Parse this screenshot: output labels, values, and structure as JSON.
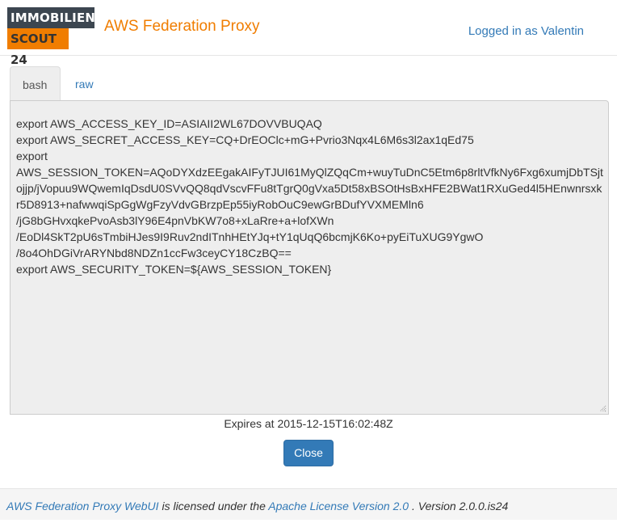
{
  "header": {
    "logo_line1": "IMMOBILIEN",
    "logo_line2": "SCOUT 24",
    "app_title": "AWS Federation Proxy",
    "user_link": "Logged in as Valentin"
  },
  "tabs": [
    {
      "label": "bash",
      "active": true
    },
    {
      "label": "raw",
      "active": false
    }
  ],
  "credentials_text": "export AWS_ACCESS_KEY_ID=ASIAII2WL67DOVVBUQAQ\nexport AWS_SECRET_ACCESS_KEY=CQ+DrEOClc+mG+Pvrio3Nqx4L6M6s3l2ax1qEd75\nexport\nAWS_SESSION_TOKEN=AQoDYXdzEEgakAIFyTJUI61MyQlZQqCm+wuyTuDnC5Etm6p8rltVfkNy6Fxg6xumjDbTSjtojjp/jVopuu9WQwemIqDsdU0SVvQQ8qdVscvFFu8tTgrQ0gVxa5Dt58xBSOtHsBxHFE2BWat1RXuGed4l5HEnwnrsxkr5D8913+nafwwqiSpGgWgFzyVdvGBrzpEp55iyRobOuC9ewGrBDufYVXMEMln6\n/jG8bGHvxqkePvoAsb3lY96E4pnVbKW7o8+xLaRre+a+lofXWn\n/EoDl4SkT2pU6sTmbiHJes9I9Ruv2ndITnhHEtYJq+tY1qUqQ6bcmjK6Ko+pyEiTuXUG9YgwO\n/8o4OhDGiVrARYNbd8NDZn1ccFw3ceyCY18CzBQ==\nexport AWS_SECURITY_TOKEN=${AWS_SESSION_TOKEN}",
  "expires_text": "Expires at 2015-12-15T16:02:48Z",
  "close_label": "Close",
  "footer": {
    "app_link": "AWS Federation Proxy WebUI",
    "licensed_text": " is licensed under the ",
    "license_link": "Apache License Version 2.0",
    "version_text": " . Version 2.0.0.is24"
  },
  "colors": {
    "brand_orange": "#f07d00",
    "logo_dark": "#3c4650",
    "link_blue": "#337ab7",
    "button_blue": "#337ab7"
  }
}
